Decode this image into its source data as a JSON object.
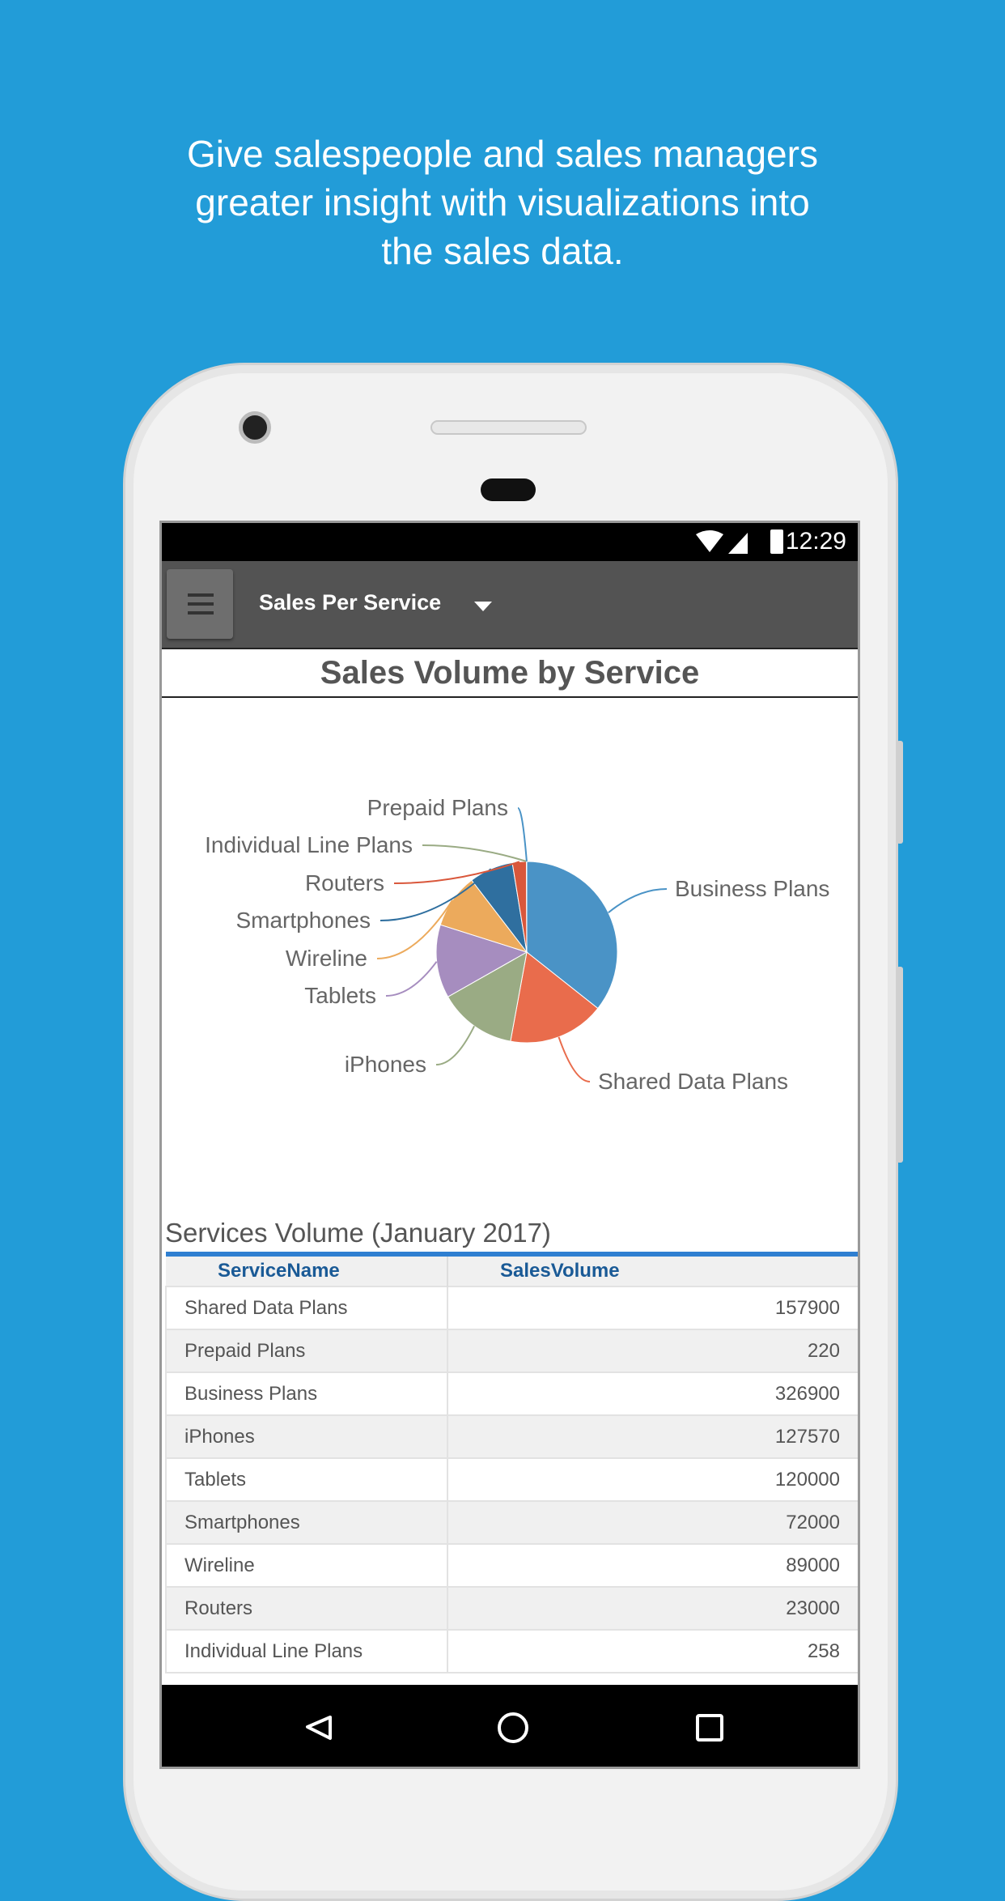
{
  "headline": [
    "Give salespeople and sales managers",
    "greater insight with visualizations into",
    "the sales data."
  ],
  "status": {
    "time": "12:29",
    "icons": [
      "wifi-icon",
      "signal-icon",
      "battery-icon"
    ]
  },
  "appbar": {
    "title": "Sales Per Service",
    "menu_icon": "hamburger-icon",
    "dropdown_icon": "caret-down-icon"
  },
  "chart_title": "Sales Volume by Service",
  "chart_data": {
    "type": "pie",
    "title": "Sales Volume by Service",
    "categories": [
      "Business Plans",
      "Shared Data Plans",
      "iPhones",
      "Tablets",
      "Wireline",
      "Smartphones",
      "Routers",
      "Individual Line Plans",
      "Prepaid Plans"
    ],
    "values": [
      326900,
      157900,
      127570,
      120000,
      89000,
      72000,
      23000,
      258,
      220
    ],
    "colors": [
      "#4a93c6",
      "#e96c4c",
      "#9aab84",
      "#a68dbf",
      "#ecaa5c",
      "#2f6f9f",
      "#d9573b",
      "#9aab84",
      "#4a93c6"
    ]
  },
  "table": {
    "caption": "Services Volume (January 2017)",
    "headers": [
      "ServiceName",
      "SalesVolume"
    ],
    "rows": [
      [
        "Shared Data Plans",
        "157900"
      ],
      [
        "Prepaid Plans",
        "220"
      ],
      [
        "Business Plans",
        "326900"
      ],
      [
        "iPhones",
        "127570"
      ],
      [
        "Tablets",
        "120000"
      ],
      [
        "Smartphones",
        "72000"
      ],
      [
        "Wireline",
        "89000"
      ],
      [
        "Routers",
        "23000"
      ],
      [
        "Individual Line Plans",
        "258"
      ]
    ],
    "accent": "#2f7fd1"
  },
  "navbar": {
    "icons": [
      "back-icon",
      "home-icon",
      "recents-icon"
    ]
  }
}
